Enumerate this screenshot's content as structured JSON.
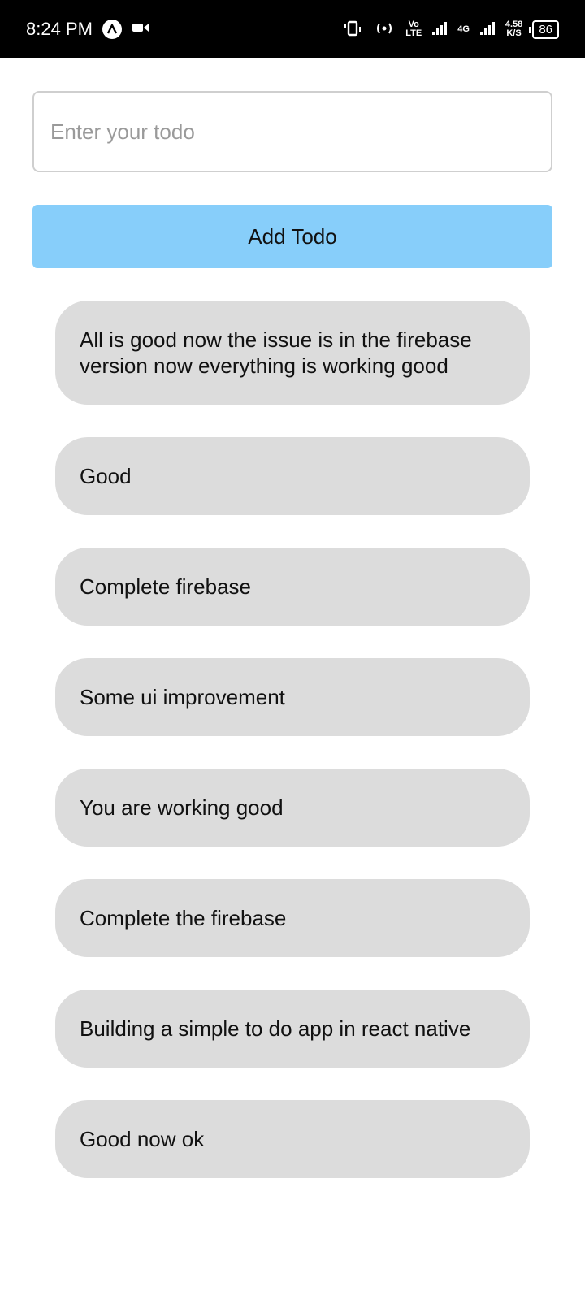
{
  "status_bar": {
    "time": "8:24 PM",
    "volte_top": "Vo",
    "volte_bottom": "LTE",
    "network_top": "4G",
    "speed_value": "4.58",
    "speed_unit": "K/S",
    "battery": "86"
  },
  "input": {
    "placeholder": "Enter your todo",
    "value": ""
  },
  "add_button": {
    "label": "Add Todo",
    "color": "#87CEFA"
  },
  "todos": [
    {
      "text": "All is good now the issue is in the firebase version now everything is working good"
    },
    {
      "text": "Good"
    },
    {
      "text": "Complete firebase"
    },
    {
      "text": "Some ui improvement"
    },
    {
      "text": "You are working good"
    },
    {
      "text": "Complete the firebase"
    },
    {
      "text": "Building a simple to do app in react native"
    },
    {
      "text": "Good now ok"
    }
  ]
}
